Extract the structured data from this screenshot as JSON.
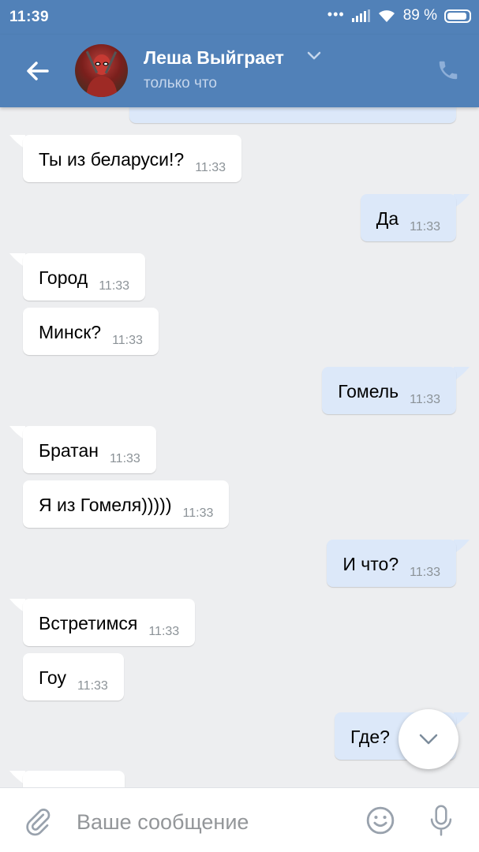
{
  "status_bar": {
    "time": "11:39",
    "signal_dots": "•••",
    "battery_percent": "89 %"
  },
  "header": {
    "contact_name": "Леша Выйграет",
    "presence": "только что"
  },
  "messages": [
    {
      "dir": "in",
      "text": "Ты из беларуси!?",
      "time": "11:33"
    },
    {
      "dir": "out",
      "text": "Да",
      "time": "11:33"
    },
    {
      "dir": "in",
      "text": "Город",
      "time": "11:33"
    },
    {
      "dir": "in",
      "text": "Минск?",
      "time": "11:33"
    },
    {
      "dir": "out",
      "text": "Гомель",
      "time": "11:33"
    },
    {
      "dir": "in",
      "text": "Братан",
      "time": "11:33"
    },
    {
      "dir": "in",
      "text": "Я из Гомеля)))))",
      "time": "11:33"
    },
    {
      "dir": "out",
      "text": "И что?",
      "time": "11:33"
    },
    {
      "dir": "in",
      "text": "Встретимся",
      "time": "11:33"
    },
    {
      "dir": "in",
      "text": "Гоу",
      "time": "11:33"
    },
    {
      "dir": "out",
      "text": "Где?",
      "time": ""
    }
  ],
  "composer": {
    "placeholder": "Ваше сообщение"
  },
  "colors": {
    "header_bg": "#5181b8",
    "chat_bg": "#edeef0",
    "incoming_bubble": "#ffffff",
    "outgoing_bubble": "#dce8f9"
  },
  "icons": {
    "back": "arrow-left-icon",
    "chevron": "chevron-down-icon",
    "call": "phone-icon",
    "scroll": "chevron-down-icon",
    "attach": "paperclip-icon",
    "emoji": "smile-icon",
    "voice": "microphone-icon"
  }
}
